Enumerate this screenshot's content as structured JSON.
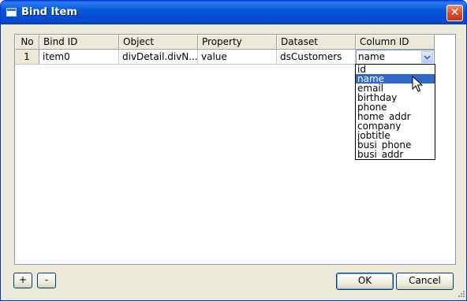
{
  "window": {
    "title": "Bind Item",
    "close_glyph": "✕",
    "title_icon": "window-icon"
  },
  "grid": {
    "columns": [
      "No",
      "Bind ID",
      "Object",
      "Property",
      "Dataset",
      "Column ID"
    ],
    "rows": [
      {
        "no": "1",
        "bind_id": "item0",
        "object": "divDetail.divN...",
        "property": "value",
        "dataset": "dsCustomers",
        "column_id": "name"
      }
    ]
  },
  "column_dropdown": {
    "current_value": "name",
    "selected": "name",
    "options": [
      "id",
      "name",
      "email",
      "birthday",
      "phone",
      "home_addr",
      "company",
      "jobtitle",
      "busi_phone",
      "busi_addr"
    ]
  },
  "buttons": {
    "add": "+",
    "remove": "-",
    "ok": "OK",
    "cancel": "Cancel"
  },
  "colors": {
    "titlebar": "#0856d8",
    "dialog_bg": "#ece9d8",
    "selection": "#316ac5"
  }
}
